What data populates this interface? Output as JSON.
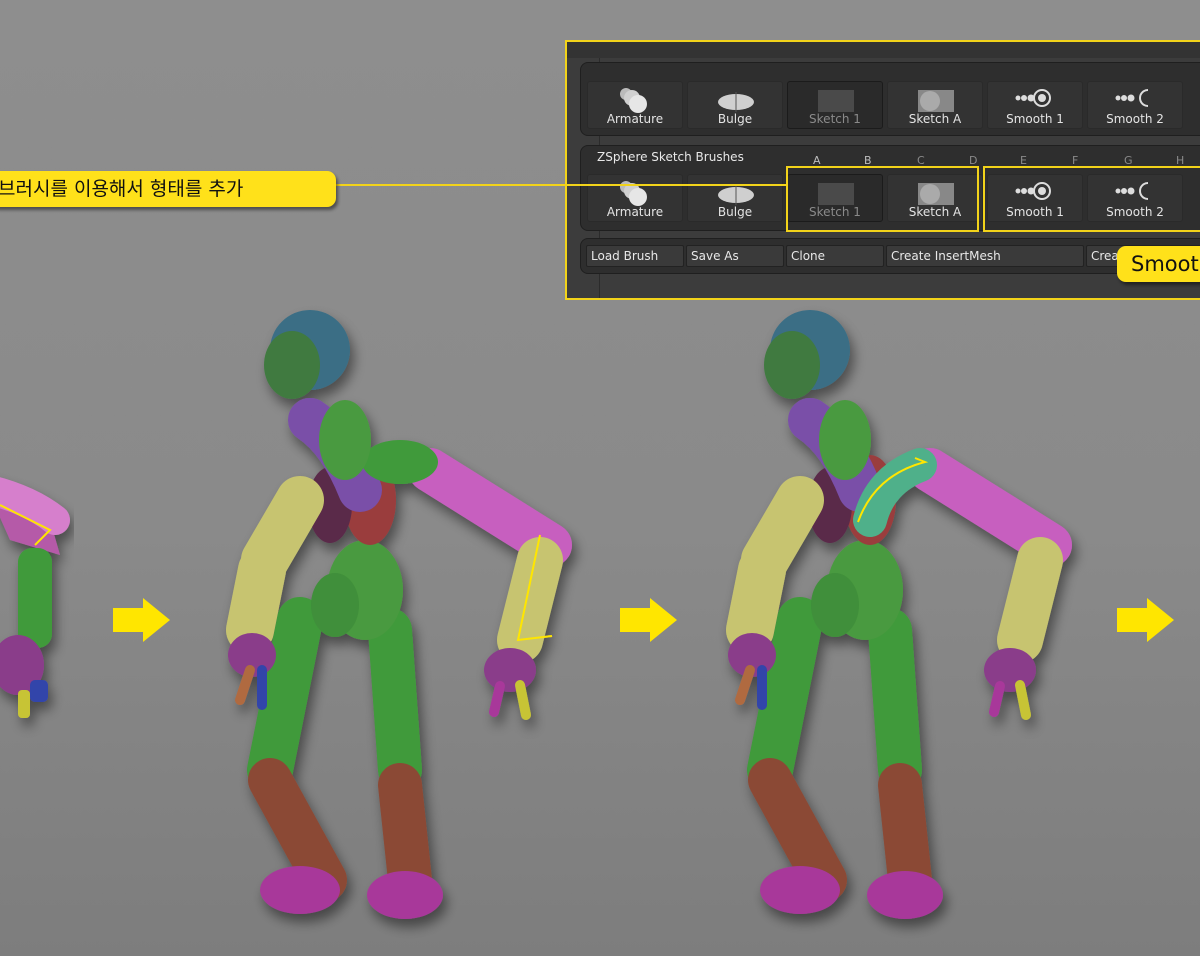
{
  "panel": {
    "section_title": "ZSphere Sketch Brushes",
    "row1_tiles": [
      {
        "label": "Armature",
        "icon": "armature-icon",
        "dim": false
      },
      {
        "label": "Bulge",
        "icon": "bulge-icon",
        "dim": false
      },
      {
        "label": "Sketch 1",
        "icon": "sketch-icon",
        "dim": true
      },
      {
        "label": "Sketch A",
        "icon": "sketch-icon",
        "dim": false
      },
      {
        "label": "Smooth 1",
        "icon": "smooth-icon",
        "dim": false
      },
      {
        "label": "Smooth 2",
        "icon": "smooth-icon",
        "dim": false
      }
    ],
    "letters": [
      "A",
      "B",
      "C",
      "D",
      "E",
      "F",
      "G",
      "H"
    ],
    "row2_tiles": [
      {
        "label": "Armature",
        "icon": "armature-icon",
        "dim": false
      },
      {
        "label": "Bulge",
        "icon": "bulge-icon",
        "dim": false
      },
      {
        "label": "Sketch 1",
        "icon": "sketch-icon",
        "dim": true
      },
      {
        "label": "Sketch A",
        "icon": "sketch-icon",
        "dim": false
      },
      {
        "label": "Smooth 1",
        "icon": "smooth-icon",
        "dim": false
      },
      {
        "label": "Smooth 2",
        "icon": "smooth-icon",
        "dim": false
      }
    ],
    "buttons": {
      "load": "Load Brush",
      "save": "Save As",
      "clone": "Clone",
      "insert": "Create InsertMesh",
      "create_cut": "Crea"
    }
  },
  "callouts": {
    "left_text": "브러시를 이용해서 형태를 추가",
    "right_text": "Smoot"
  },
  "colors": {
    "highlight": "#f2d31a",
    "callout_bg": "#ffe11a",
    "arrow": "#ffe600"
  }
}
